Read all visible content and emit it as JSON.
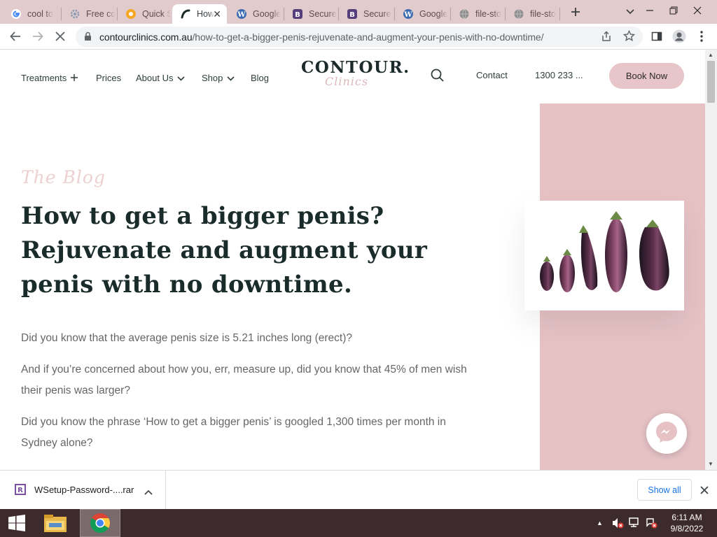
{
  "browser": {
    "tabs": [
      {
        "title": "cool to",
        "favicon": "google-g-icon"
      },
      {
        "title": "Free co",
        "favicon": "gear-favicon-icon"
      },
      {
        "title": "Quick S",
        "favicon": "quick-favicon-icon"
      },
      {
        "title": "How",
        "favicon": "contour-favicon-icon",
        "active": true
      },
      {
        "title": "Google",
        "favicon": "wordpress-icon"
      },
      {
        "title": "Secure",
        "favicon": "bootstrap-b-icon"
      },
      {
        "title": "Secure",
        "favicon": "bootstrap-b-icon"
      },
      {
        "title": "Google",
        "favicon": "wordpress-icon"
      },
      {
        "title": "file-sto",
        "favicon": "globe-icon"
      },
      {
        "title": "file-sto",
        "favicon": "globe-icon"
      }
    ],
    "url_domain": "contourclinics.com.au",
    "url_path": "/how-to-get-a-bigger-penis-rejuvenate-and-augment-your-penis-with-no-downtime/"
  },
  "site": {
    "nav_left": [
      {
        "label": "Treatments",
        "icon": "plus-icon"
      },
      {
        "label": "Prices",
        "icon": ""
      },
      {
        "label": "About Us",
        "icon": "chevron-down-icon"
      },
      {
        "label": "Shop",
        "icon": "chevron-down-icon"
      },
      {
        "label": "Blog",
        "icon": ""
      }
    ],
    "logo_word": "CONTOUR.",
    "logo_script": "Clinics",
    "contact": "Contact",
    "phone": "1300 233 ...",
    "book_now": "Book Now",
    "blog_script": "The Blog",
    "headline": "How to get a bigger penis? Rejuvenate and augment your penis with no downtime.",
    "paragraphs": [
      "Did you know that the average penis size is 5.21 inches long (erect)?",
      "And if you’re concerned about how you, err, measure up, did you know that 45% of men wish their penis was larger?",
      "Did you know the phrase ‘How to get a bigger penis’ is googled 1,300 times per month in Sydney alone?"
    ],
    "colors": {
      "accent_pink": "#e6c2c5",
      "heading": "#1a2c2a",
      "body_text": "#666666"
    }
  },
  "downloads": {
    "file_name": "WSetup-Password-....rar",
    "show_all": "Show all"
  },
  "taskbar": {
    "time": "6:11 AM",
    "date": "9/8/2022"
  }
}
